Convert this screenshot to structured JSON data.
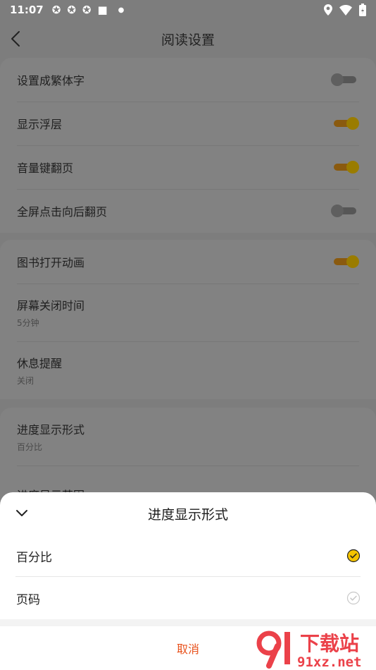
{
  "status_bar": {
    "time": "11:07"
  },
  "header": {
    "title": "阅读设置"
  },
  "settings": {
    "group1": [
      {
        "label": "设置成繁体字",
        "on": false
      },
      {
        "label": "显示浮层",
        "on": true
      },
      {
        "label": "音量键翻页",
        "on": true
      },
      {
        "label": "全屏点击向后翻页",
        "on": false
      }
    ],
    "group2": {
      "animation": {
        "label": "图书打开动画",
        "on": true
      },
      "screen_off": {
        "label": "屏幕关闭时间",
        "value": "5分钟"
      },
      "rest": {
        "label": "休息提醒",
        "value": "关闭"
      }
    },
    "group3": {
      "progress_form": {
        "label": "进度显示形式",
        "value": "百分比"
      },
      "progress_range": {
        "label": "进度显示范围"
      }
    }
  },
  "sheet": {
    "title": "进度显示形式",
    "options": [
      {
        "label": "百分比",
        "selected": true
      },
      {
        "label": "页码",
        "selected": false
      }
    ],
    "cancel": "取消"
  },
  "watermark": {
    "text": "下载站",
    "domain": "91xz.net"
  },
  "colors": {
    "accent": "#F5C400",
    "cancel": "#E8501A",
    "toggle_track_on": "#F09A20"
  }
}
